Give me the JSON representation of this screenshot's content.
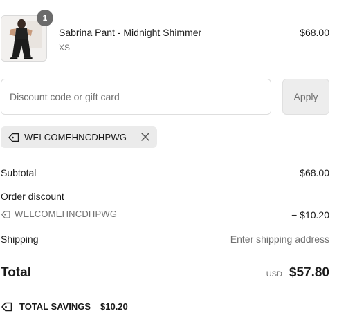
{
  "line_item": {
    "quantity": "1",
    "title": "Sabrina Pant - Midnight Shimmer",
    "variant": "XS",
    "price": "$68.00",
    "thumbnail_icon": "product-photo"
  },
  "discount": {
    "placeholder": "Discount code or gift card",
    "value": "",
    "apply_label": "Apply",
    "applied_code": "WELCOMEHNCDHPWG"
  },
  "summary": {
    "subtotal_label": "Subtotal",
    "subtotal_value": "$68.00",
    "order_discount_label": "Order discount",
    "discount_code": "WELCOMEHNCDHPWG",
    "discount_value": "− $10.20",
    "shipping_label": "Shipping",
    "shipping_value": "Enter shipping address",
    "total_label": "Total",
    "total_currency": "USD",
    "total_value": "$57.80",
    "savings_label": "TOTAL SAVINGS",
    "savings_value": "$10.20"
  },
  "colors": {
    "text": "#1a1a1a",
    "muted": "#707070",
    "badge": "#6b6b6b",
    "tag_bg": "#ebebeb",
    "button_bg": "#ededed"
  }
}
